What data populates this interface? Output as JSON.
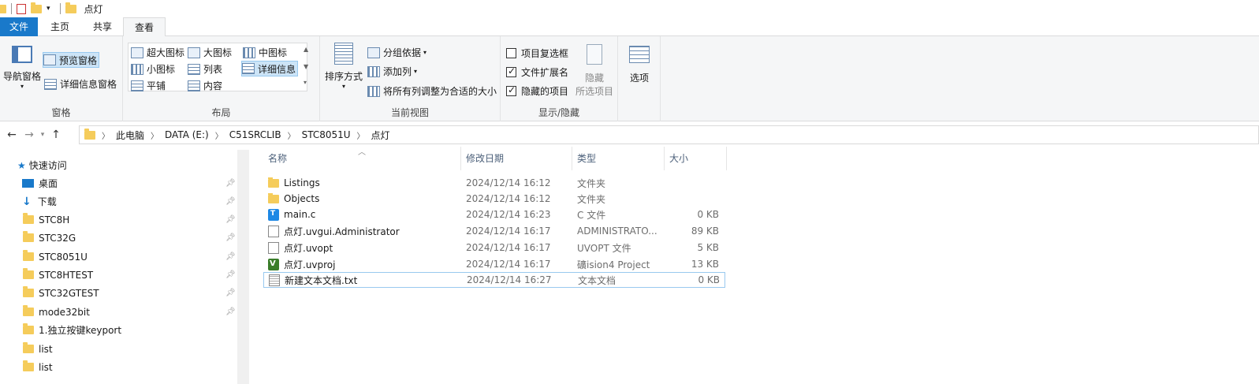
{
  "window": {
    "title": "点灯"
  },
  "tabs": [
    {
      "label": "文件"
    },
    {
      "label": "主页"
    },
    {
      "label": "共享"
    },
    {
      "label": "查看"
    }
  ],
  "ribbon": {
    "panes": {
      "nav_pane": "导航窗格",
      "preview_pane": "预览窗格",
      "details_pane": "详细信息窗格",
      "group_label": "窗格"
    },
    "layout": {
      "extra_large": "超大图标",
      "large": "大图标",
      "medium": "中图标",
      "small": "小图标",
      "list": "列表",
      "details": "详细信息",
      "tiles": "平铺",
      "content": "内容",
      "group_label": "布局"
    },
    "current_view": {
      "sort_by": "排序方式",
      "group_by": "分组依据",
      "add_columns": "添加列",
      "size_all_columns": "将所有列调整为合适的大小",
      "group_label": "当前视图"
    },
    "show_hide": {
      "item_checkboxes": "项目复选框",
      "item_checkboxes_checked": false,
      "file_extensions": "文件扩展名",
      "file_extensions_checked": true,
      "hidden_items": "隐藏的项目",
      "hidden_items_checked": true,
      "hide_selected": "隐藏",
      "hide_selected_2": "所选项目",
      "group_label": "显示/隐藏"
    },
    "options": "选项"
  },
  "address": {
    "crumbs": [
      "此电脑",
      "DATA (E:)",
      "C51SRCLIB",
      "STC8051U",
      "点灯"
    ]
  },
  "nav_pane": {
    "quick_access": "快速访问",
    "items": [
      {
        "label": "桌面",
        "icon": "desktop-icon",
        "pinned": true
      },
      {
        "label": "下载",
        "icon": "download-icon",
        "pinned": true
      },
      {
        "label": "STC8H",
        "icon": "folder-icon",
        "pinned": true
      },
      {
        "label": "STC32G",
        "icon": "folder-icon",
        "pinned": true
      },
      {
        "label": "STC8051U",
        "icon": "folder-icon",
        "pinned": true
      },
      {
        "label": "STC8HTEST",
        "icon": "folder-icon",
        "pinned": true
      },
      {
        "label": "STC32GTEST",
        "icon": "folder-icon",
        "pinned": true
      },
      {
        "label": "mode32bit",
        "icon": "folder-icon",
        "pinned": true
      },
      {
        "label": "1.独立按键keyport",
        "icon": "folder-icon",
        "pinned": false
      },
      {
        "label": "list",
        "icon": "folder-icon",
        "pinned": false
      },
      {
        "label": "list",
        "icon": "folder-icon",
        "pinned": false
      }
    ]
  },
  "file_list": {
    "columns": {
      "name": "名称",
      "date": "修改日期",
      "type": "类型",
      "size": "大小"
    },
    "rows": [
      {
        "name": "Listings",
        "date": "2024/12/14 16:12",
        "type": "文件夹",
        "size": "",
        "icon": "folder"
      },
      {
        "name": "Objects",
        "date": "2024/12/14 16:12",
        "type": "文件夹",
        "size": "",
        "icon": "folder"
      },
      {
        "name": "main.c",
        "date": "2024/12/14 16:23",
        "type": "C 文件",
        "size": "0 KB",
        "icon": "c"
      },
      {
        "name": "点灯.uvgui.Administrator",
        "date": "2024/12/14 16:17",
        "type": "ADMINISTRATO...",
        "size": "89 KB",
        "icon": "doc"
      },
      {
        "name": "点灯.uvopt",
        "date": "2024/12/14 16:17",
        "type": "UVOPT 文件",
        "size": "5 KB",
        "icon": "doc"
      },
      {
        "name": "点灯.uvproj",
        "date": "2024/12/14 16:17",
        "type": "礦ision4 Project",
        "size": "13 KB",
        "icon": "uv"
      },
      {
        "name": "新建文本文档.txt",
        "date": "2024/12/14 16:27",
        "type": "文本文档",
        "size": "0 KB",
        "icon": "txt",
        "selected": true
      }
    ]
  }
}
